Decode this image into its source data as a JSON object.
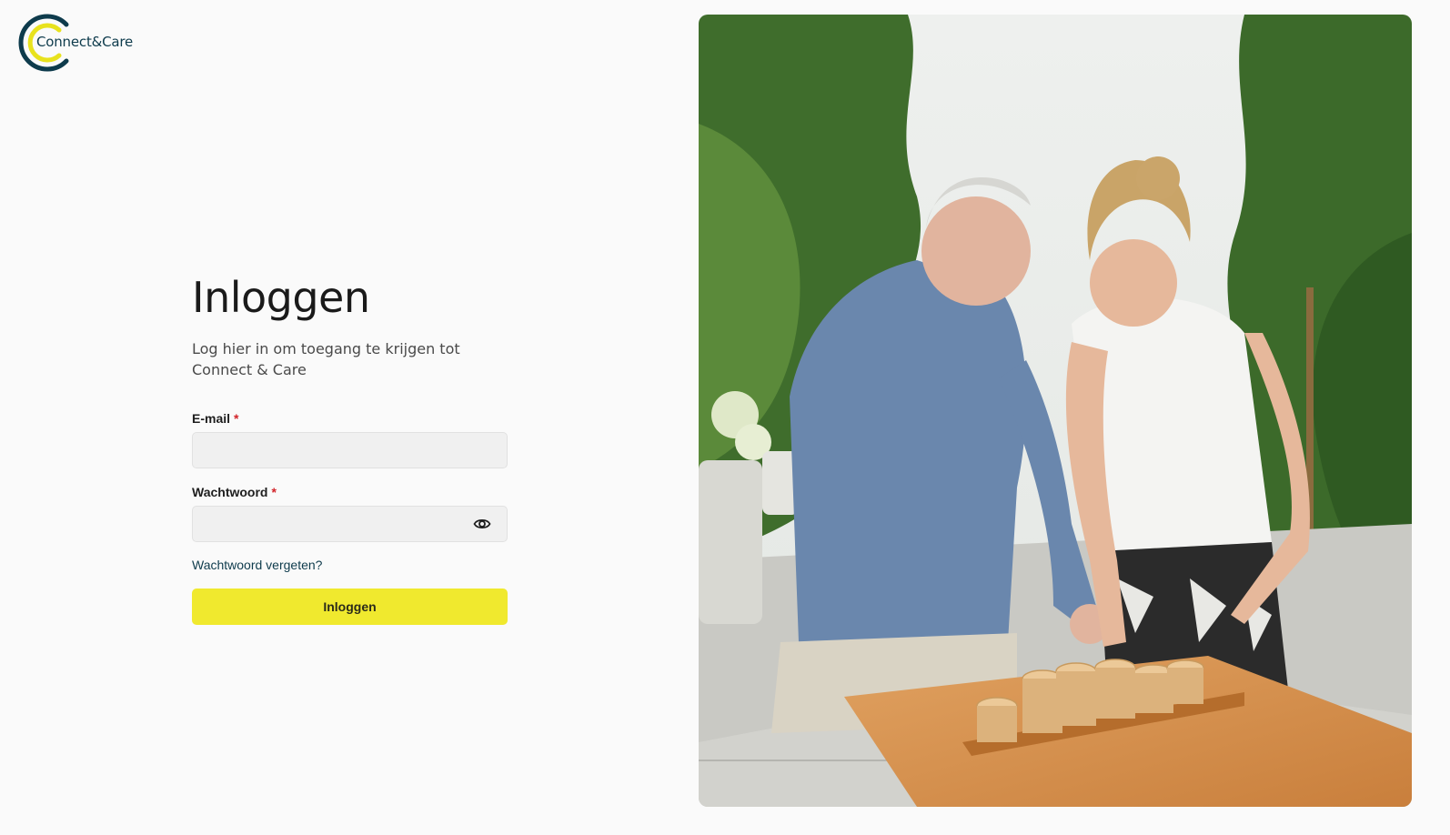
{
  "brand": {
    "name": "Connect&Care",
    "colors": {
      "navy": "#0e3b4c",
      "yellow": "#f0e92e"
    }
  },
  "login": {
    "title": "Inloggen",
    "subtitle": "Log hier in om toegang te krijgen tot Connect & Care",
    "email_label": "E-mail",
    "required_marker": "*",
    "email_value": "",
    "password_label": "Wachtwoord",
    "password_value": "",
    "toggle_icon": "eye-icon",
    "forgot_link": "Wachtwoord vergeten?",
    "submit_label": "Inloggen"
  }
}
